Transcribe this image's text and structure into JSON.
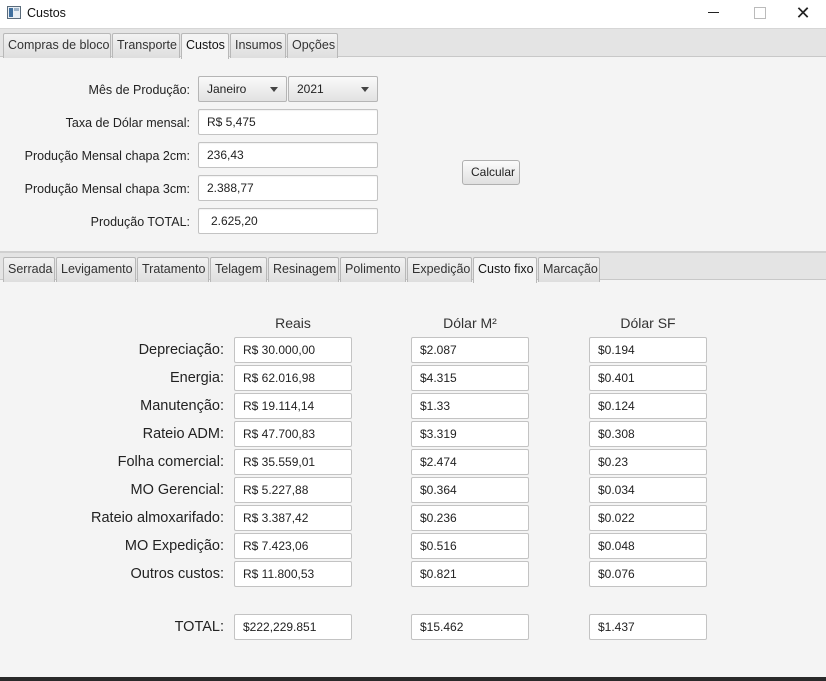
{
  "window": {
    "title": "Custos",
    "close_glyph": "✕"
  },
  "main_tabs": [
    {
      "label": "Compras de bloco"
    },
    {
      "label": "Transporte"
    },
    {
      "label": "Custos"
    },
    {
      "label": "Insumos"
    },
    {
      "label": "Opções"
    }
  ],
  "form": {
    "month_label": "Mês de Produção:",
    "month_value": "Janeiro",
    "year_value": "2021",
    "dollar_label": "Taxa de Dólar mensal:",
    "dollar_value": "R$ 5,475",
    "prod2_label": "Produção Mensal chapa 2cm:",
    "prod2_value": "236,43",
    "prod3_label": "Produção Mensal chapa 3cm:",
    "prod3_value": "2.388,77",
    "total_label": "Produção TOTAL:",
    "total_value": "2.625,20",
    "calc_button": "Calcular"
  },
  "sub_tabs": [
    {
      "label": "Serrada"
    },
    {
      "label": "Levigamento"
    },
    {
      "label": "Tratamento"
    },
    {
      "label": "Telagem"
    },
    {
      "label": "Resinagem"
    },
    {
      "label": "Polimento"
    },
    {
      "label": "Expedição"
    },
    {
      "label": "Custo fixo"
    },
    {
      "label": "Marcação"
    }
  ],
  "table": {
    "headers": [
      "Reais",
      "Dólar M²",
      "Dólar SF"
    ],
    "rows": [
      {
        "label": "Depreciação:",
        "reais": "R$ 30.000,00",
        "dolar_m2": "$2.087",
        "dolar_sf": "$0.194"
      },
      {
        "label": "Energia:",
        "reais": "R$ 62.016,98",
        "dolar_m2": "$4.315",
        "dolar_sf": "$0.401"
      },
      {
        "label": "Manutenção:",
        "reais": "R$ 19.114,14",
        "dolar_m2": "$1.33",
        "dolar_sf": "$0.124"
      },
      {
        "label": "Rateio ADM:",
        "reais": "R$ 47.700,83",
        "dolar_m2": "$3.319",
        "dolar_sf": "$0.308"
      },
      {
        "label": "Folha comercial:",
        "reais": "R$ 35.559,01",
        "dolar_m2": "$2.474",
        "dolar_sf": "$0.23"
      },
      {
        "label": "MO Gerencial:",
        "reais": "R$ 5.227,88",
        "dolar_m2": "$0.364",
        "dolar_sf": "$0.034"
      },
      {
        "label": "Rateio almoxarifado:",
        "reais": "R$ 3.387,42",
        "dolar_m2": "$0.236",
        "dolar_sf": "$0.022"
      },
      {
        "label": "MO Expedição:",
        "reais": "R$ 7.423,06",
        "dolar_m2": "$0.516",
        "dolar_sf": "$0.048"
      },
      {
        "label": "Outros custos:",
        "reais": "R$ 11.800,53",
        "dolar_m2": "$0.821",
        "dolar_sf": "$0.076"
      }
    ],
    "total": {
      "label": "TOTAL:",
      "reais": "$222,229.851",
      "dolar_m2": "$15.462",
      "dolar_sf": "$1.437"
    }
  }
}
